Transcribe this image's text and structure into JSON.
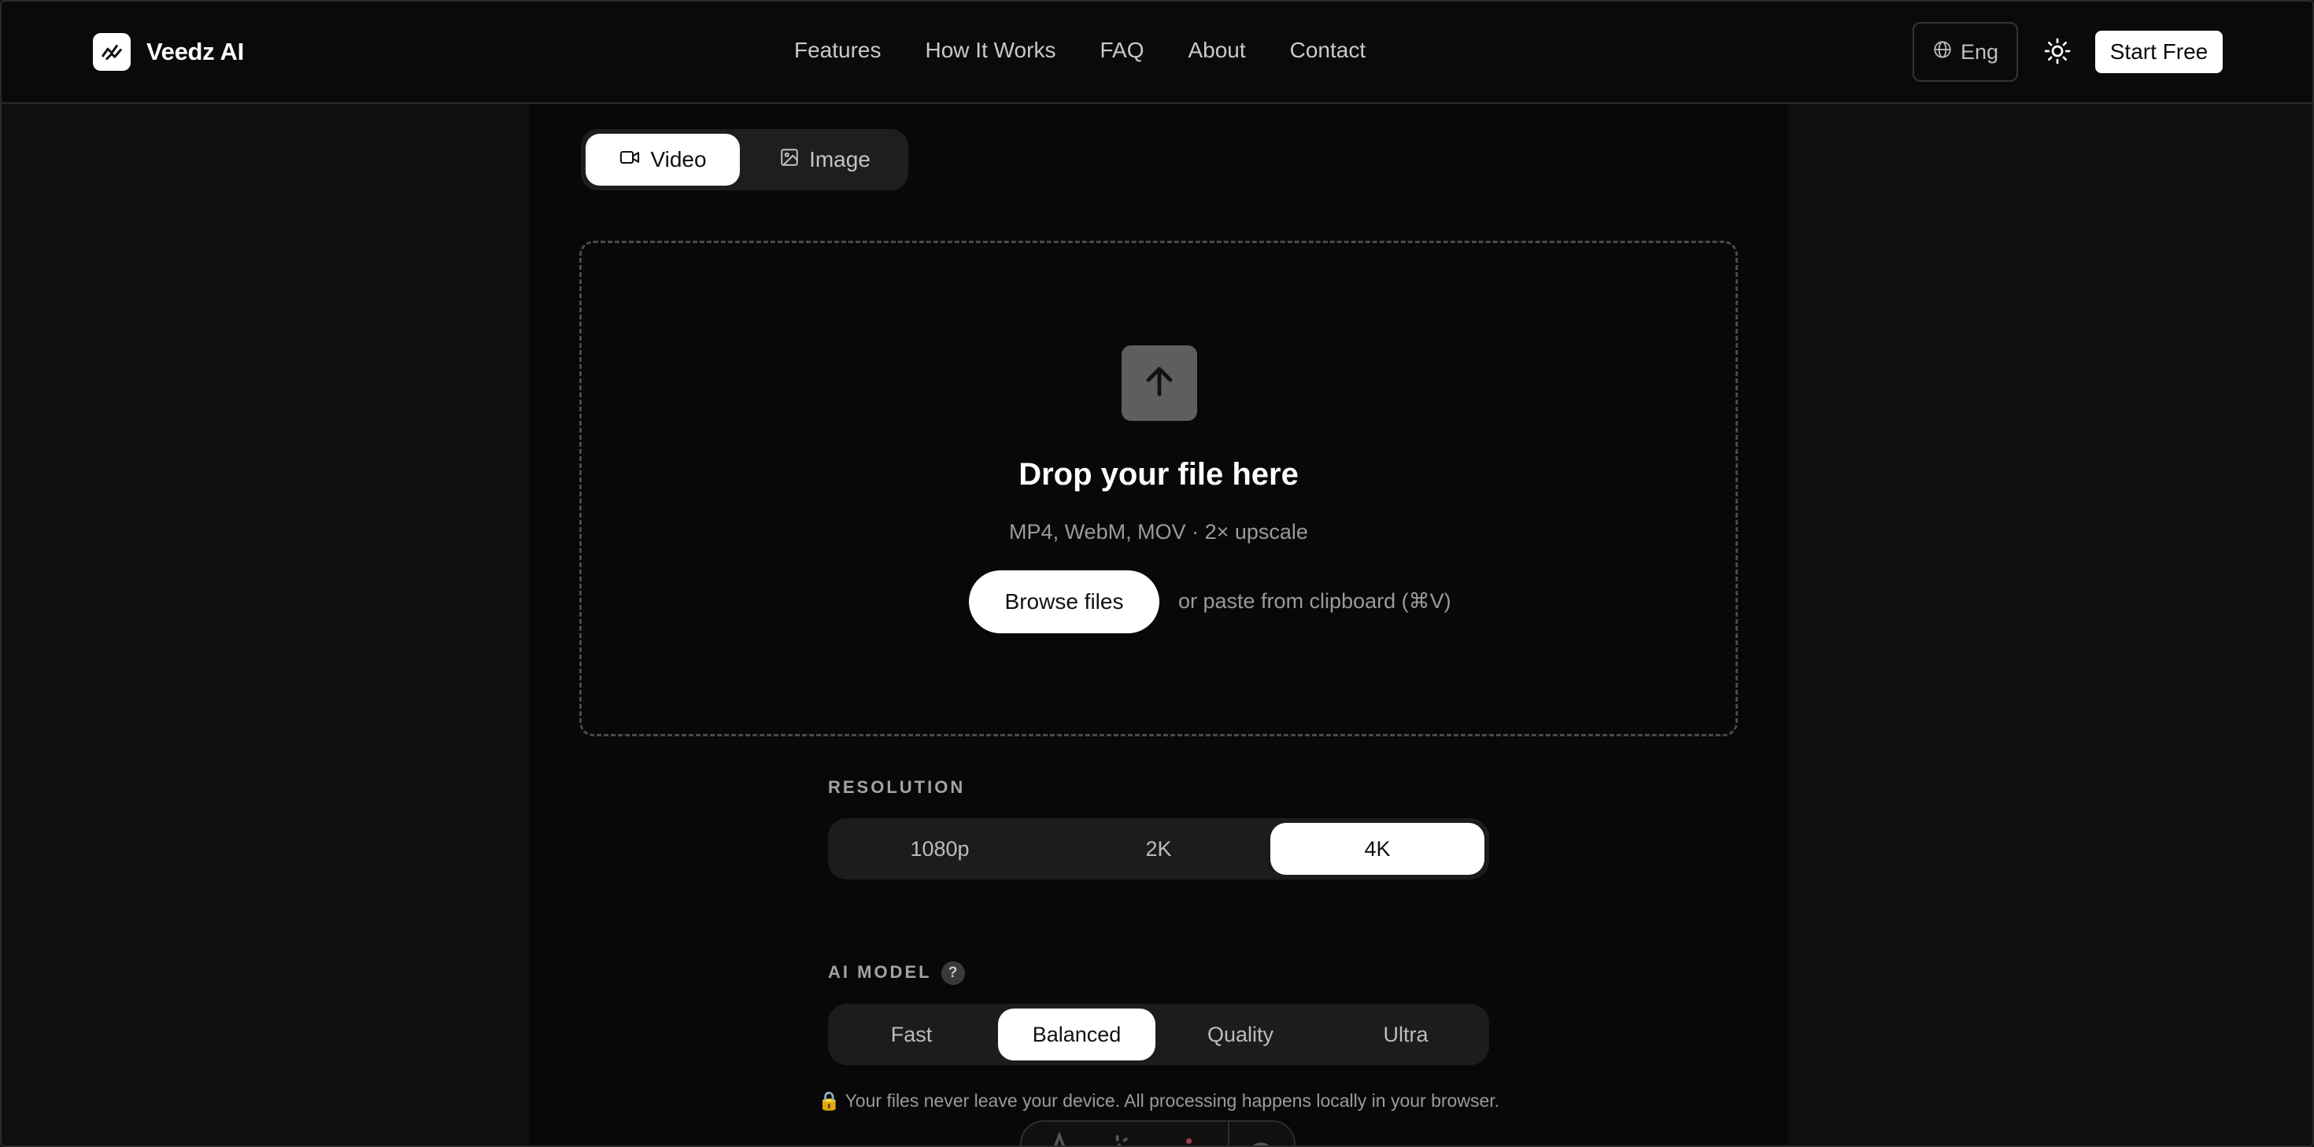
{
  "brand": {
    "name": "Veedz AI",
    "logo_icon": "trend-chart-icon"
  },
  "nav": {
    "items": [
      "Features",
      "How It Works",
      "FAQ",
      "About",
      "Contact"
    ]
  },
  "header": {
    "language": "Eng",
    "language_icon": "globe-icon",
    "theme_icon": "sun-icon",
    "cta": "Start Free"
  },
  "media_tabs": [
    {
      "label": "Video",
      "icon": "video-camera-icon",
      "selected": true
    },
    {
      "label": "Image",
      "icon": "image-icon",
      "selected": false
    }
  ],
  "dropzone": {
    "icon": "arrow-up-icon",
    "title": "Drop your file here",
    "subtitle": "MP4, WebM, MOV · 2× upscale",
    "browse_label": "Browse files",
    "paste_hint": "or paste from clipboard (⌘V)"
  },
  "resolution": {
    "label": "RESOLUTION",
    "options": [
      "1080p",
      "2K",
      "4K"
    ],
    "selected": "4K"
  },
  "ai_model": {
    "label": "AI MODEL",
    "help": "?",
    "options": [
      "Fast",
      "Balanced",
      "Quality",
      "Ultra"
    ],
    "selected": "Balanced"
  },
  "privacy": {
    "icon": "lock-icon",
    "text": "🔒 Your files never leave your device. All processing happens locally in your browser."
  },
  "colors": {
    "page_bg": "#0f0f0f",
    "panel_bg": "#080808",
    "accent": "#ffffff",
    "muted_text": "#9a9a9a"
  }
}
